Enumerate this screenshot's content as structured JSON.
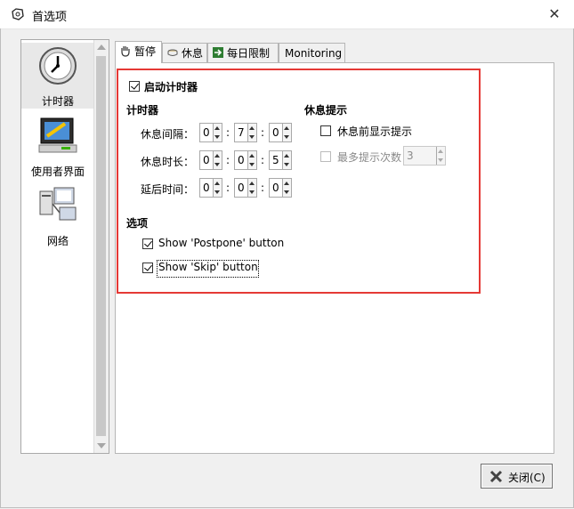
{
  "window": {
    "title": "首选项",
    "close_glyph": "✕"
  },
  "sidebar": {
    "items": [
      {
        "label": "计时器",
        "icon": "clock-icon",
        "active": true
      },
      {
        "label": "使用者界面",
        "icon": "monitor-icon",
        "active": false
      },
      {
        "label": "网络",
        "icon": "network-icon",
        "active": false
      }
    ]
  },
  "tabs": [
    {
      "label": "暂停",
      "icon": "hand-icon",
      "active": true
    },
    {
      "label": "休息",
      "icon": "cup-icon",
      "active": false
    },
    {
      "label": "每日限制",
      "icon": "exit-icon",
      "active": false
    },
    {
      "label": "Monitoring",
      "icon": "",
      "active": false
    }
  ],
  "panel": {
    "enable_timer_label": "启动计时器",
    "enable_timer_checked": true,
    "timer_heading": "计时器",
    "rows": [
      {
        "label": "休息间隔：",
        "h": "0",
        "m": "7",
        "s": "0"
      },
      {
        "label": "休息时长：",
        "h": "0",
        "m": "0",
        "s": "5"
      },
      {
        "label": "延后时间：",
        "h": "0",
        "m": "0",
        "s": "0"
      }
    ],
    "separator": ":",
    "hint_heading": "休息提示",
    "show_hint_label": "休息前显示提示",
    "show_hint_checked": false,
    "max_hints_label": "最多提示次数",
    "max_hints_value": "3",
    "options_heading": "选项",
    "show_postpone_label": "Show 'Postpone' button",
    "show_postpone_checked": true,
    "show_skip_label": "Show 'Skip' button",
    "show_skip_checked": true
  },
  "footer": {
    "close_label": "关闭(C)"
  },
  "colors": {
    "highlight": "#e53935"
  }
}
